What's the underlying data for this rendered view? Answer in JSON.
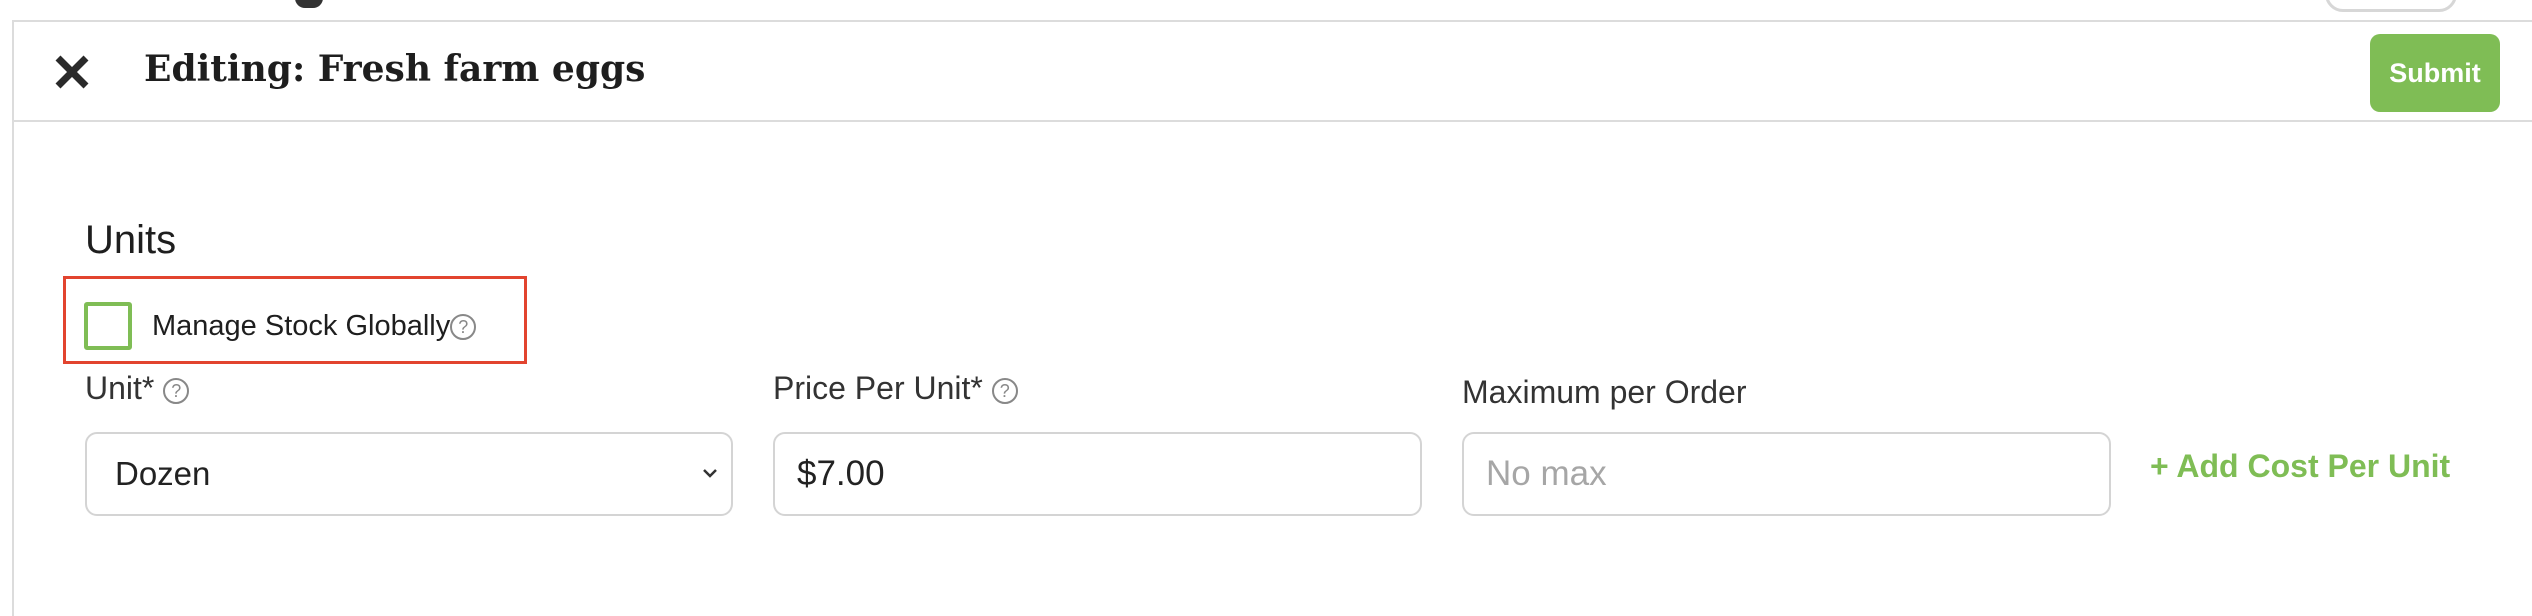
{
  "header": {
    "title": "Editing: Fresh farm eggs",
    "submit_label": "Submit",
    "close_icon": "close-icon"
  },
  "units": {
    "section_title": "Units",
    "manage_stock_label": "Manage Stock Globally",
    "manage_stock_checked": false,
    "help_glyph": "?",
    "unit": {
      "label": "Unit*",
      "value": "Dozen"
    },
    "price": {
      "label": "Price Per Unit*",
      "value": "$7.00"
    },
    "max_order": {
      "label": "Maximum per Order",
      "value": "",
      "placeholder": "No max"
    },
    "add_cost_label": "+ Add Cost Per Unit"
  },
  "colors": {
    "accent": "#7fbd55",
    "highlight": "#e2442f",
    "border": "#d4d4d4"
  }
}
